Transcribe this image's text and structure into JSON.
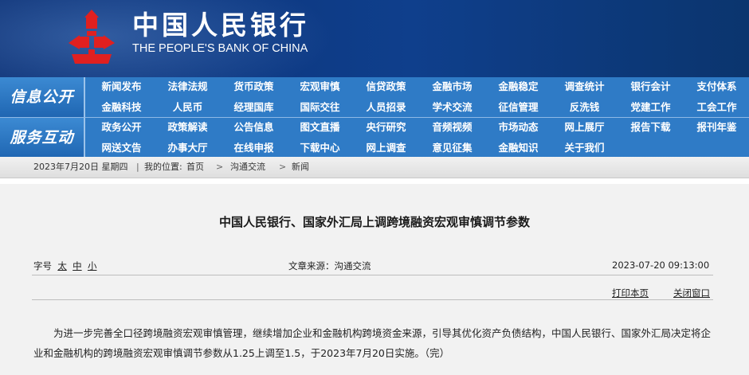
{
  "header": {
    "brand_cn": "中国人民银行",
    "brand_en": "THE PEOPLE'S BANK OF CHINA"
  },
  "nav": {
    "group1_label": "信息公开",
    "group1_items": [
      "新闻发布",
      "法律法规",
      "货币政策",
      "宏观审慎",
      "信贷政策",
      "金融市场",
      "金融稳定",
      "调查统计",
      "银行会计",
      "支付体系",
      "金融科技",
      "人民币",
      "经理国库",
      "国际交往",
      "人员招录",
      "学术交流",
      "征信管理",
      "反洗钱",
      "党建工作",
      "工会工作"
    ],
    "group2_label": "服务互动",
    "group2_items": [
      "政务公开",
      "政策解读",
      "公告信息",
      "图文直播",
      "央行研究",
      "音频视频",
      "市场动态",
      "网上展厅",
      "报告下载",
      "报刊年鉴",
      "网送文告",
      "办事大厅",
      "在线申报",
      "下载中心",
      "网上调查",
      "意见征集",
      "金融知识",
      "关于我们"
    ]
  },
  "breadcrumb": {
    "date": "2023年7月20日 星期四",
    "sep": "|",
    "location_label": "我的位置:",
    "home": "首页",
    "arrow": ">",
    "section": "沟通交流",
    "current": "新闻"
  },
  "article": {
    "title": "中国人民银行、国家外汇局上调跨境融资宏观审慎调节参数",
    "font_size_label": "字号",
    "font_sizes": [
      "太",
      "中",
      "小"
    ],
    "source": "文章来源：沟通交流",
    "datetime": "2023-07-20  09:13:00",
    "print_label": "打印本页",
    "close_label": "关闭窗口",
    "body": "为进一步完善全口径跨境融资宏观审慎管理，继续增加企业和金融机构跨境资金来源，引导其优化资产负债结构，中国人民银行、国家外汇局决定将企业和金融机构的跨境融资宏观审慎调节参数从1.25上调至1.5，于2023年7月20日实施。（完）"
  },
  "colors": {
    "header_bg": "#0f3f8c",
    "nav_bg": "#2f7bc6",
    "logo_red": "#e02020"
  },
  "icons": {
    "logo": "pboc-ancient-coin-logo-icon"
  }
}
